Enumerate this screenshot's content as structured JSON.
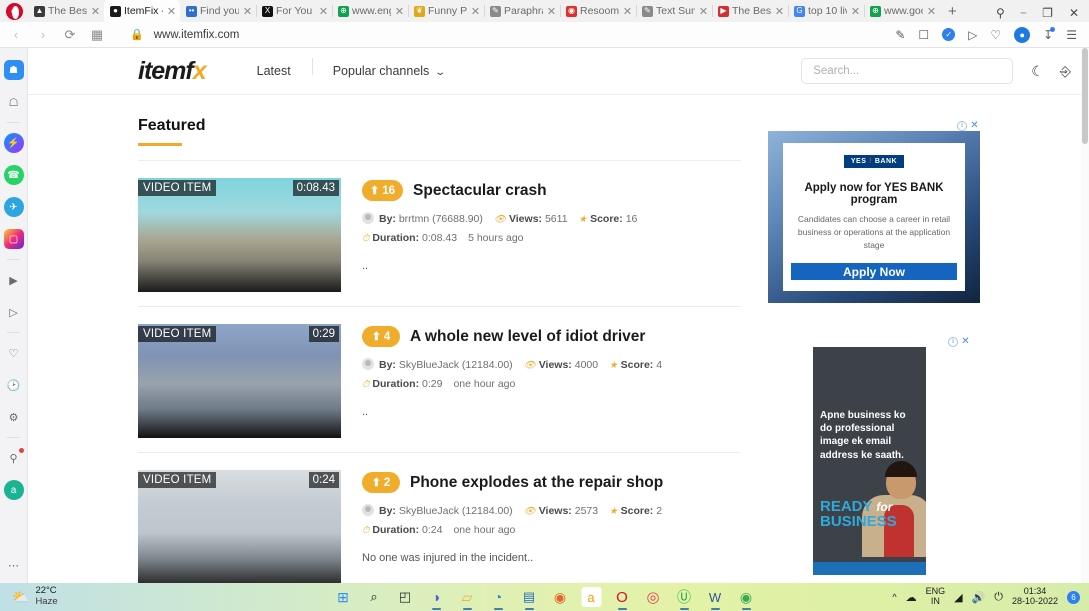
{
  "browser": {
    "tabs": [
      {
        "title": "The Best",
        "favicon": "mountain-icon",
        "color": "#3a3a3a",
        "active": false
      },
      {
        "title": "ItemFix -",
        "favicon": "itemfix-icon",
        "color": "#1b1b1b",
        "active": true
      },
      {
        "title": "Find your",
        "favicon": "dots-icon",
        "color": "#2f6fd0",
        "active": false
      },
      {
        "title": "For You -",
        "favicon": "x-icon",
        "color": "#111111",
        "active": false
      },
      {
        "title": "www.eng",
        "favicon": "globe-icon",
        "color": "#12a150",
        "active": false
      },
      {
        "title": "Funny Pi",
        "favicon": "bee-icon",
        "color": "#e0a81a",
        "active": false
      },
      {
        "title": "Paraphra",
        "favicon": "quill-icon",
        "color": "#8a8a8a",
        "active": false
      },
      {
        "title": "Resoome",
        "favicon": "resoomer-icon",
        "color": "#e0302e",
        "active": false
      },
      {
        "title": "Text Sum",
        "favicon": "quill-icon",
        "color": "#8a8a8a",
        "active": false
      },
      {
        "title": "The Best",
        "favicon": "video-icon",
        "color": "#d32f2f",
        "active": false
      },
      {
        "title": "top 10 liv",
        "favicon": "google-icon",
        "color": "#4285f4",
        "active": false
      },
      {
        "title": "www.goo",
        "favicon": "globe-icon",
        "color": "#12a150",
        "active": false
      }
    ],
    "new_tab_label": "+",
    "window_controls": {
      "search": "search-icon",
      "restore": "restore-icon",
      "close": "close-icon"
    },
    "address": {
      "back": "back-icon",
      "forward": "forward-icon",
      "reload": "reload-icon",
      "tiles": "tiles-icon",
      "lock": "lock-icon",
      "url": "www.itemfix.com"
    },
    "toolbar_icons": [
      "snapshot-icon",
      "camera-icon",
      "verified-badge-icon",
      "send-icon",
      "heart-icon",
      "profile-avatar-icon",
      "download-icon",
      "menu-icon"
    ],
    "sidebar_icons": [
      "opera-home-icon",
      "bookmarks-icon",
      "divider",
      "messenger-icon",
      "whatsapp-icon",
      "telegram-icon",
      "instagram-icon",
      "divider",
      "player-icon",
      "vpn-send-icon",
      "divider",
      "favorites-heart-icon",
      "history-clock-icon",
      "settings-gear-icon",
      "divider",
      "tips-bulb-icon",
      "amazon-icon",
      "more-dots-icon"
    ]
  },
  "site": {
    "logo": {
      "text_main": "itemf",
      "text_accent": "x",
      "name": "itemfix-logo"
    },
    "nav": [
      {
        "label": "Latest",
        "name": "nav-latest"
      },
      {
        "label": "Popular channels",
        "name": "nav-popular-channels"
      }
    ],
    "search": {
      "placeholder": "Search...",
      "value": ""
    },
    "header_icons": [
      "dark-mode-moon-icon",
      "user-account-icon"
    ],
    "section_title": "Featured",
    "videos": [
      {
        "badge": "VIDEO ITEM",
        "duration_badge": "0:08.43",
        "votes": "16",
        "title": "Spectacular crash",
        "by_label": "By:",
        "by": "brrtmn (76688.90)",
        "views_label": "Views:",
        "views": "5611",
        "score_label": "Score:",
        "score": "16",
        "duration_label": "Duration:",
        "duration": "0:08.43",
        "time_ago": "5 hours ago",
        "description": ".."
      },
      {
        "badge": "VIDEO ITEM",
        "duration_badge": "0:29",
        "votes": "4",
        "title": "A whole new level of idiot driver",
        "by_label": "By:",
        "by": "SkyBlueJack (12184.00)",
        "views_label": "Views:",
        "views": "4000",
        "score_label": "Score:",
        "score": "4",
        "duration_label": "Duration:",
        "duration": "0:29",
        "time_ago": "one hour ago",
        "description": ".."
      },
      {
        "badge": "VIDEO ITEM",
        "duration_badge": "0:24",
        "votes": "2",
        "title": "Phone explodes at the repair shop",
        "by_label": "By:",
        "by": "SkyBlueJack (12184.00)",
        "views_label": "Views:",
        "views": "2573",
        "score_label": "Score:",
        "score": "2",
        "duration_label": "Duration:",
        "duration": "0:24",
        "time_ago": "one hour ago",
        "description": "No one was injured in the incident.."
      }
    ],
    "ads": [
      {
        "brand": "YES BANK",
        "brand_left": "YES",
        "brand_right": "BANK",
        "headline": "Apply now for YES BANK program",
        "body": "Candidates can choose a career in retail business or operations at the application stage",
        "cta": "Apply Now",
        "info_icon": "ad-info-icon",
        "close_icon": "ad-close-icon"
      },
      {
        "headline": "Apne business ko do professional image ek email address ke saath.",
        "tag_line1": "READY",
        "tag_italic": "for",
        "tag_line2": "BUSINESS",
        "info_icon": "ad-info-icon",
        "close_icon": "ad-close-icon"
      }
    ]
  },
  "taskbar": {
    "weather": {
      "temp": "22°C",
      "condition": "Haze",
      "icon": "sun-cloud-icon"
    },
    "apps": [
      {
        "name": "start-button",
        "glyph": "windows-icon"
      },
      {
        "name": "taskbar-search",
        "glyph": "search-icon"
      },
      {
        "name": "taskbar-taskview",
        "glyph": "taskview-icon"
      },
      {
        "name": "taskbar-chat",
        "glyph": "chat-icon"
      },
      {
        "name": "taskbar-file-explorer",
        "glyph": "folder-icon"
      },
      {
        "name": "taskbar-edge",
        "glyph": "edge-icon"
      },
      {
        "name": "taskbar-store",
        "glyph": "store-icon"
      },
      {
        "name": "taskbar-firefox",
        "glyph": "firefox-icon"
      },
      {
        "name": "taskbar-amazon",
        "glyph": "amazon-icon"
      },
      {
        "name": "taskbar-opera",
        "glyph": "opera-icon"
      },
      {
        "name": "taskbar-opera-gx",
        "glyph": "opera-gx-icon"
      },
      {
        "name": "taskbar-utorrent",
        "glyph": "utorrent-icon"
      },
      {
        "name": "taskbar-word",
        "glyph": "word-icon"
      },
      {
        "name": "taskbar-chrome",
        "glyph": "chrome-icon"
      }
    ],
    "tray": {
      "chevron": "show-hidden-icons",
      "lang_top": "ENG",
      "lang_bottom": "IN",
      "wifi": "wifi-icon",
      "volume": "volume-icon",
      "battery": "battery-icon",
      "time": "01:34",
      "date": "28-10-2022",
      "notification_count": "6"
    }
  }
}
